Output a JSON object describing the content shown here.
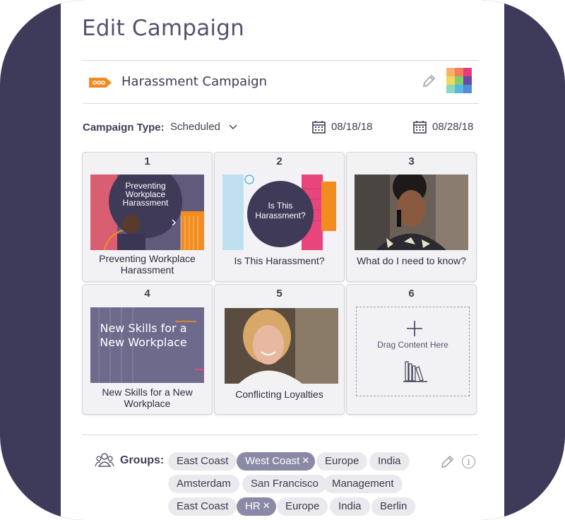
{
  "page": {
    "title": "Edit Campaign"
  },
  "campaign": {
    "name": "Harassment Campaign",
    "tag_icon": "tag-icon",
    "edit_icon": "pencil-icon"
  },
  "color_grid": [
    "#f7b26a",
    "#f47d61",
    "#e73c7a",
    "#f2d75f",
    "#7fcf6b",
    "#6a47a8",
    "#8fd8c0",
    "#58b6e6",
    "#4f8fd6"
  ],
  "campaign_type": {
    "label": "Campaign Type:",
    "value": "Scheduled"
  },
  "dates": {
    "start": "08/18/18",
    "end": "08/28/18"
  },
  "tiles": [
    {
      "num": "1",
      "caption": "Preventing Workplace Harassment",
      "thumb_title": "Preventing Workplace Harassment"
    },
    {
      "num": "2",
      "caption": "Is This Harassment?",
      "thumb_title": "Is This Harassment?"
    },
    {
      "num": "3",
      "caption": "What do I need to know?"
    },
    {
      "num": "4",
      "caption": "New Skills for a New Workplace",
      "thumb_title": "New Skills for a New Workplace"
    },
    {
      "num": "5",
      "caption": "Conflicting Loyalties"
    },
    {
      "num": "6",
      "dropzone_text": "Drag Content Here"
    }
  ],
  "groups": {
    "label": "Groups:",
    "chips": [
      {
        "label": "East Coast",
        "selected": false
      },
      {
        "label": "West Coast",
        "selected": true
      },
      {
        "label": "Europe",
        "selected": false
      },
      {
        "label": "India",
        "selected": false
      },
      {
        "label": "Amsterdam",
        "selected": false
      },
      {
        "label": "San Francisco",
        "selected": false
      },
      {
        "label": "Management",
        "selected": false
      },
      {
        "label": "East Coast",
        "selected": false
      },
      {
        "label": "HR",
        "selected": true
      },
      {
        "label": "Europe",
        "selected": false
      },
      {
        "label": "India",
        "selected": false
      },
      {
        "label": "Berlin",
        "selected": false
      }
    ],
    "info_icon": "i"
  }
}
